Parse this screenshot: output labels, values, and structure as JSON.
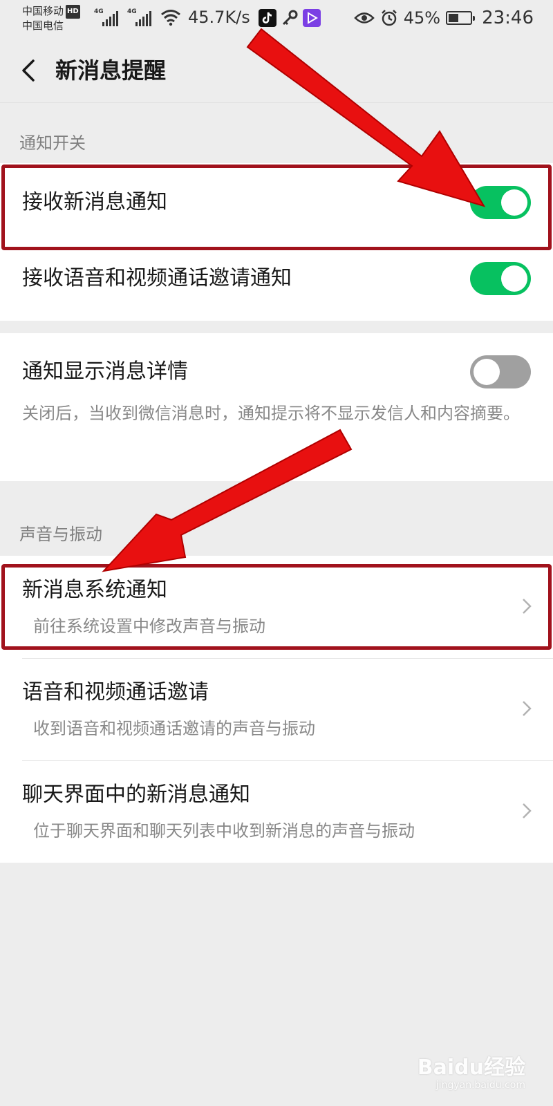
{
  "status_bar": {
    "carrier_1": "中国移动",
    "carrier_1_badge": "HD",
    "carrier_2": "中国电信",
    "network_1": "4G",
    "network_2": "4G",
    "net_speed": "45.7K/s",
    "battery_pct": "45%",
    "time": "23:46",
    "icons": [
      "signal-icon",
      "wifi-icon",
      "tiktok-icon",
      "key-icon",
      "video-app-icon",
      "eye-icon",
      "alarm-icon",
      "battery-icon"
    ]
  },
  "nav": {
    "title": "新消息提醒",
    "back_icon": "back-arrow-icon"
  },
  "sections": {
    "notification_switch_header": "通知开关",
    "sound_vibration_header": "声音与振动"
  },
  "toggles": [
    {
      "label": "接收新消息通知",
      "state": "on"
    },
    {
      "label": "接收语音和视频通话邀请通知",
      "state": "on"
    }
  ],
  "detail_toggle": {
    "label": "通知显示消息详情",
    "state": "off",
    "description": "关闭后，当收到微信消息时，通知提示将不显示发信人和内容摘要。"
  },
  "sound_items": [
    {
      "title": "新消息系统通知",
      "subtitle": "前往系统设置中修改声音与振动"
    },
    {
      "title": "语音和视频通话邀请",
      "subtitle": "收到语音和视频通话邀请的声音与振动"
    },
    {
      "title": "聊天界面中的新消息通知",
      "subtitle": "位于聊天界面和聊天列表中收到新消息的声音与振动"
    }
  ],
  "colors": {
    "toggle_on": "#07c160",
    "toggle_off": "#a0a0a0",
    "annotation_arrow": "#e81010",
    "annotation_box": "#a1121c",
    "background": "#ededed"
  },
  "watermark": {
    "brand": "Baidu经验",
    "url": "jingyan.baidu.com"
  }
}
